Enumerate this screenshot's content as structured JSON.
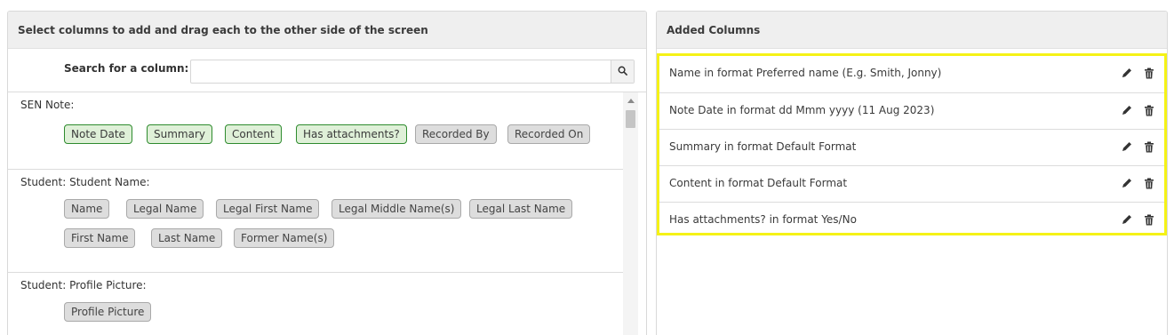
{
  "left_panel": {
    "title": "Select columns to add and drag each to the other side of the screen",
    "search": {
      "label": "Search for a column:",
      "value": "",
      "placeholder": ""
    },
    "groups": [
      {
        "title": "SEN Note:",
        "chips": [
          {
            "label": "Note Date",
            "added": true
          },
          {
            "label": "Summary",
            "added": true
          },
          {
            "label": "Content",
            "added": true
          },
          {
            "label": "Has attachments?",
            "added": true
          },
          {
            "label": "Recorded By",
            "added": false
          },
          {
            "label": "Recorded On",
            "added": false
          }
        ]
      },
      {
        "title": "Student: Student Name:",
        "chips": [
          {
            "label": "Name",
            "added": false
          },
          {
            "label": "Legal Name",
            "added": false
          },
          {
            "label": "Legal First Name",
            "added": false
          },
          {
            "label": "Legal Middle Name(s)",
            "added": false
          },
          {
            "label": "Legal Last Name",
            "added": false
          },
          {
            "label": "First Name",
            "added": false
          },
          {
            "label": "Last Name",
            "added": false
          },
          {
            "label": "Former Name(s)",
            "added": false
          }
        ]
      },
      {
        "title": "Student: Profile Picture:",
        "chips": [
          {
            "label": "Profile Picture",
            "added": false
          }
        ]
      }
    ]
  },
  "right_panel": {
    "title": "Added Columns",
    "rows": [
      {
        "text": "Name in format Preferred name (E.g. Smith, Jonny)"
      },
      {
        "text": "Note Date in format dd Mmm yyyy (11 Aug 2023)"
      },
      {
        "text": "Summary in format Default Format"
      },
      {
        "text": "Content in format Default Format"
      },
      {
        "text": "Has attachments? in format Yes/No"
      }
    ]
  },
  "colors": {
    "highlight": "#f5f216",
    "added_chip_border": "#2e8b2e",
    "added_chip_bg": "#dff0d8",
    "chip_bg": "#dddddd"
  },
  "icons": {
    "search": "search-icon",
    "edit": "pencil-icon",
    "delete": "trash-icon"
  }
}
